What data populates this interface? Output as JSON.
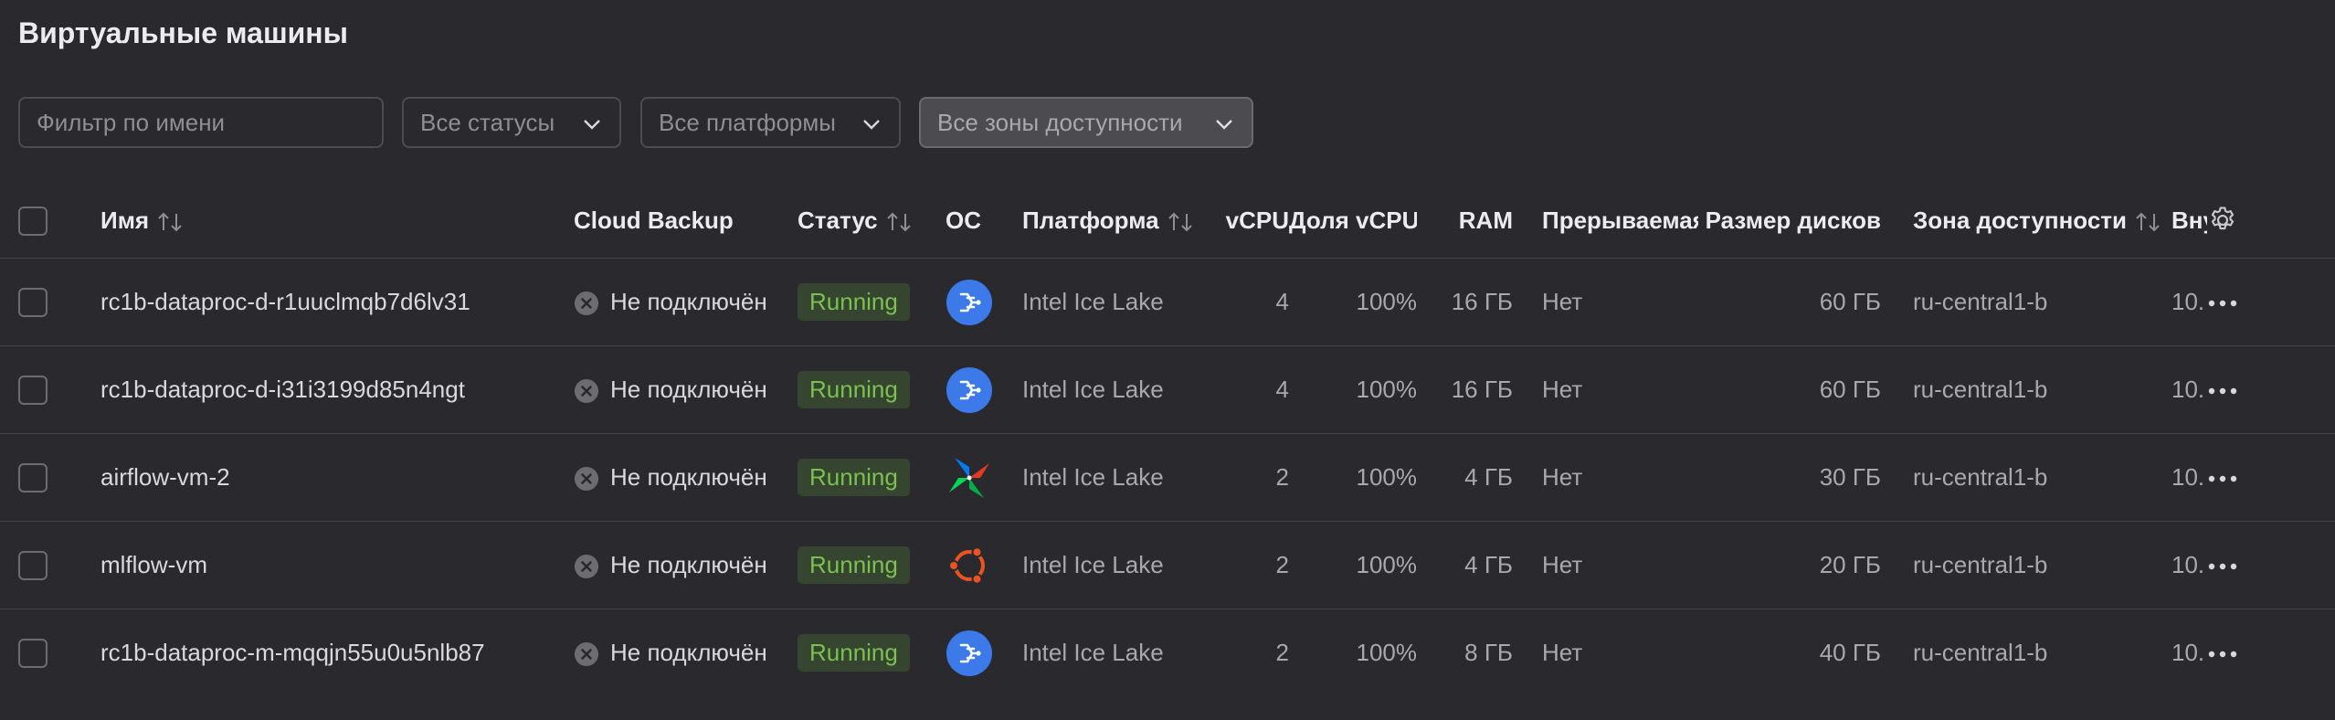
{
  "page": {
    "title": "Виртуальные машины"
  },
  "filters": {
    "name_placeholder": "Фильтр по имени",
    "status": "Все статусы",
    "platform": "Все платформы",
    "zone": "Все зоны доступности"
  },
  "columns": {
    "name": "Имя",
    "backup": "Cloud Backup",
    "status": "Статус",
    "os": "ОС",
    "platform": "Платформа",
    "vcpu": "vCPU",
    "vcpu_share": "Доля vCPU",
    "ram": "RAM",
    "preemptible": "Прерываемая",
    "disk_size": "Размер дисков",
    "zone": "Зона доступности",
    "internal_ip": "Вну"
  },
  "rows": [
    {
      "name": "rc1b-dataproc-d-r1uuclmqb7d6lv31",
      "backup": "Не подключён",
      "status": "Running",
      "os": "dataproc-icon",
      "platform": "Intel Ice Lake",
      "vcpu": "4",
      "vcpu_share": "100%",
      "ram": "16 ГБ",
      "preemptible": "Нет",
      "disk_size": "60 ГБ",
      "zone": "ru-central1-b",
      "ip": "10."
    },
    {
      "name": "rc1b-dataproc-d-i31i3199d85n4ngt",
      "backup": "Не подключён",
      "status": "Running",
      "os": "dataproc-icon",
      "platform": "Intel Ice Lake",
      "vcpu": "4",
      "vcpu_share": "100%",
      "ram": "16 ГБ",
      "preemptible": "Нет",
      "disk_size": "60 ГБ",
      "zone": "ru-central1-b",
      "ip": "10."
    },
    {
      "name": "airflow-vm-2",
      "backup": "Не подключён",
      "status": "Running",
      "os": "airflow-icon",
      "platform": "Intel Ice Lake",
      "vcpu": "2",
      "vcpu_share": "100%",
      "ram": "4 ГБ",
      "preemptible": "Нет",
      "disk_size": "30 ГБ",
      "zone": "ru-central1-b",
      "ip": "10."
    },
    {
      "name": "mlflow-vm",
      "backup": "Не подключён",
      "status": "Running",
      "os": "ubuntu-icon",
      "platform": "Intel Ice Lake",
      "vcpu": "2",
      "vcpu_share": "100%",
      "ram": "4 ГБ",
      "preemptible": "Нет",
      "disk_size": "20 ГБ",
      "zone": "ru-central1-b",
      "ip": "10."
    },
    {
      "name": "rc1b-dataproc-m-mqqjn55u0u5nlb87",
      "backup": "Не подключён",
      "status": "Running",
      "os": "dataproc-icon",
      "platform": "Intel Ice Lake",
      "vcpu": "2",
      "vcpu_share": "100%",
      "ram": "8 ГБ",
      "preemptible": "Нет",
      "disk_size": "40 ГБ",
      "zone": "ru-central1-b",
      "ip": "10."
    }
  ],
  "colors": {
    "status_running_bg": "#35452f",
    "status_running_text": "#7cc14f",
    "dataproc_blue": "#3b7ae8",
    "ubuntu_orange": "#e95420"
  }
}
